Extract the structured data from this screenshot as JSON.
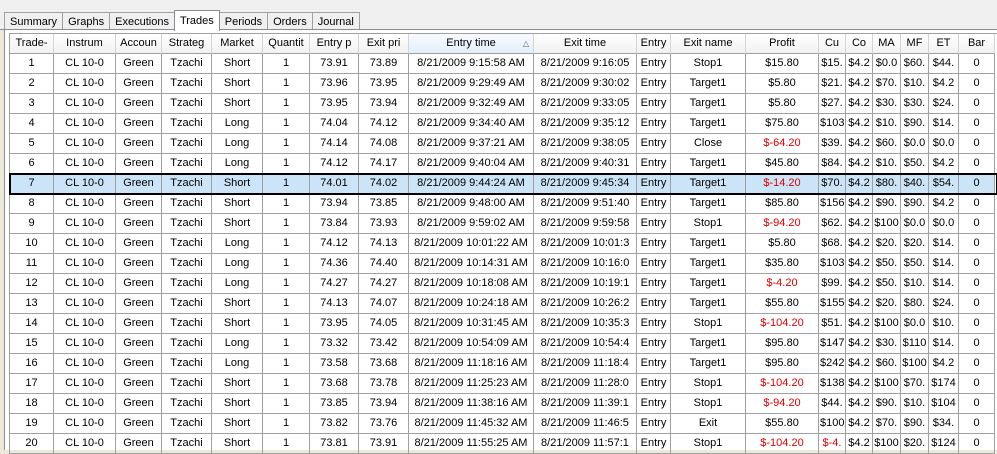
{
  "tabs": [
    {
      "label": "Summary"
    },
    {
      "label": "Graphs"
    },
    {
      "label": "Executions"
    },
    {
      "label": "Trades"
    },
    {
      "label": "Periods"
    },
    {
      "label": "Orders"
    },
    {
      "label": "Journal"
    }
  ],
  "active_tab": "Trades",
  "table": {
    "headers": [
      "Trade-",
      "Instrum",
      "Accoun",
      "Strateg",
      "Market",
      "Quantit",
      "Entry p",
      "Exit pri",
      "Entry time",
      "Exit time",
      "Entry",
      "Exit name",
      "Profit",
      "Cu",
      "Co",
      "MA",
      "MF",
      "ET",
      "Bar"
    ],
    "sorted_column": "Entry time",
    "sort_direction": "ascending",
    "selected_row": 7,
    "negative_color": "#e00000",
    "selected_bg": "#cce4f7",
    "rows": [
      [
        "1",
        "CL 10-0",
        "Green",
        "Tzachi",
        "Short",
        "1",
        "73.91",
        "73.89",
        "8/21/2009 9:15:58 AM",
        "8/21/2009 9:16:05",
        "Entry",
        "Stop1",
        "$15.80",
        "$15.",
        "$4.2",
        "$0.0",
        "$60.",
        "$44.",
        "0"
      ],
      [
        "2",
        "CL 10-0",
        "Green",
        "Tzachi",
        "Short",
        "1",
        "73.96",
        "73.95",
        "8/21/2009 9:29:49 AM",
        "8/21/2009 9:30:02",
        "Entry",
        "Target1",
        "$5.80",
        "$21.",
        "$4.2",
        "$70.",
        "$10.",
        "$4.2",
        "0"
      ],
      [
        "3",
        "CL 10-0",
        "Green",
        "Tzachi",
        "Short",
        "1",
        "73.95",
        "73.94",
        "8/21/2009 9:32:49 AM",
        "8/21/2009 9:33:05",
        "Entry",
        "Target1",
        "$5.80",
        "$27.",
        "$4.2",
        "$30.",
        "$30.",
        "$24.",
        "0"
      ],
      [
        "4",
        "CL 10-0",
        "Green",
        "Tzachi",
        "Long",
        "1",
        "74.04",
        "74.12",
        "8/21/2009 9:34:40 AM",
        "8/21/2009 9:35:12",
        "Entry",
        "Target1",
        "$75.80",
        "$103",
        "$4.2",
        "$10.",
        "$90.",
        "$14.",
        "0"
      ],
      [
        "5",
        "CL 10-0",
        "Green",
        "Tzachi",
        "Long",
        "1",
        "74.14",
        "74.08",
        "8/21/2009 9:37:21 AM",
        "8/21/2009 9:38:05",
        "Entry",
        "Close",
        "$-64.20",
        "$39.",
        "$4.2",
        "$60.",
        "$0.0",
        "$0.0",
        "0"
      ],
      [
        "6",
        "CL 10-0",
        "Green",
        "Tzachi",
        "Long",
        "1",
        "74.12",
        "74.17",
        "8/21/2009 9:40:04 AM",
        "8/21/2009 9:40:31",
        "Entry",
        "Target1",
        "$45.80",
        "$84.",
        "$4.2",
        "$10.",
        "$50.",
        "$4.2",
        "0"
      ],
      [
        "7",
        "CL 10-0",
        "Green",
        "Tzachi",
        "Short",
        "1",
        "74.01",
        "74.02",
        "8/21/2009 9:44:24 AM",
        "8/21/2009 9:45:34",
        "Entry",
        "Target1",
        "$-14.20",
        "$70.",
        "$4.2",
        "$80.",
        "$40.",
        "$54.",
        "0"
      ],
      [
        "8",
        "CL 10-0",
        "Green",
        "Tzachi",
        "Short",
        "1",
        "73.94",
        "73.85",
        "8/21/2009 9:48:00 AM",
        "8/21/2009 9:51:40",
        "Entry",
        "Target1",
        "$85.80",
        "$156",
        "$4.2",
        "$90.",
        "$90.",
        "$4.2",
        "0"
      ],
      [
        "9",
        "CL 10-0",
        "Green",
        "Tzachi",
        "Short",
        "1",
        "73.84",
        "73.93",
        "8/21/2009 9:59:02 AM",
        "8/21/2009 9:59:58",
        "Entry",
        "Stop1",
        "$-94.20",
        "$62.",
        "$4.2",
        "$100",
        "$0.0",
        "$0.0",
        "0"
      ],
      [
        "10",
        "CL 10-0",
        "Green",
        "Tzachi",
        "Long",
        "1",
        "74.12",
        "74.13",
        "8/21/2009 10:01:22 AM",
        "8/21/2009 10:01:3",
        "Entry",
        "Target1",
        "$5.80",
        "$68.",
        "$4.2",
        "$20.",
        "$20.",
        "$14.",
        "0"
      ],
      [
        "11",
        "CL 10-0",
        "Green",
        "Tzachi",
        "Long",
        "1",
        "74.36",
        "74.40",
        "8/21/2009 10:14:31 AM",
        "8/21/2009 10:16:0",
        "Entry",
        "Target1",
        "$35.80",
        "$103",
        "$4.2",
        "$50.",
        "$50.",
        "$14.",
        "0"
      ],
      [
        "12",
        "CL 10-0",
        "Green",
        "Tzachi",
        "Long",
        "1",
        "74.27",
        "74.27",
        "8/21/2009 10:18:08 AM",
        "8/21/2009 10:19:1",
        "Entry",
        "Target1",
        "$-4.20",
        "$99.",
        "$4.2",
        "$50.",
        "$10.",
        "$14.",
        "0"
      ],
      [
        "13",
        "CL 10-0",
        "Green",
        "Tzachi",
        "Short",
        "1",
        "74.13",
        "74.07",
        "8/21/2009 10:24:18 AM",
        "8/21/2009 10:26:2",
        "Entry",
        "Target1",
        "$55.80",
        "$155",
        "$4.2",
        "$20.",
        "$80.",
        "$24.",
        "0"
      ],
      [
        "14",
        "CL 10-0",
        "Green",
        "Tzachi",
        "Short",
        "1",
        "73.95",
        "74.05",
        "8/21/2009 10:31:45 AM",
        "8/21/2009 10:35:3",
        "Entry",
        "Stop1",
        "$-104.20",
        "$51.",
        "$4.2",
        "$100",
        "$0.0",
        "$10.",
        "0"
      ],
      [
        "15",
        "CL 10-0",
        "Green",
        "Tzachi",
        "Long",
        "1",
        "73.32",
        "73.42",
        "8/21/2009 10:54:09 AM",
        "8/21/2009 10:54:4",
        "Entry",
        "Target1",
        "$95.80",
        "$147",
        "$4.2",
        "$30.",
        "$110",
        "$14.",
        "0"
      ],
      [
        "16",
        "CL 10-0",
        "Green",
        "Tzachi",
        "Long",
        "1",
        "73.58",
        "73.68",
        "8/21/2009 11:18:16 AM",
        "8/21/2009 11:18:4",
        "Entry",
        "Target1",
        "$95.80",
        "$242",
        "$4.2",
        "$60.",
        "$100",
        "$4.2",
        "0"
      ],
      [
        "17",
        "CL 10-0",
        "Green",
        "Tzachi",
        "Short",
        "1",
        "73.68",
        "73.78",
        "8/21/2009 11:25:23 AM",
        "8/21/2009 11:28:0",
        "Entry",
        "Stop1",
        "$-104.20",
        "$138",
        "$4.2",
        "$100",
        "$70.",
        "$174",
        "0"
      ],
      [
        "18",
        "CL 10-0",
        "Green",
        "Tzachi",
        "Short",
        "1",
        "73.85",
        "73.94",
        "8/21/2009 11:38:16 AM",
        "8/21/2009 11:39:1",
        "Entry",
        "Stop1",
        "$-94.20",
        "$44.",
        "$4.2",
        "$90.",
        "$10.",
        "$104",
        "0"
      ],
      [
        "19",
        "CL 10-0",
        "Green",
        "Tzachi",
        "Short",
        "1",
        "73.82",
        "73.76",
        "8/21/2009 11:45:32 AM",
        "8/21/2009 11:46:5",
        "Entry",
        "Exit",
        "$55.80",
        "$100",
        "$4.2",
        "$70.",
        "$90.",
        "$34.",
        "0"
      ],
      [
        "20",
        "CL 10-0",
        "Green",
        "Tzachi",
        "Short",
        "1",
        "73.81",
        "73.91",
        "8/21/2009 11:55:25 AM",
        "8/21/2009 11:57:1",
        "Entry",
        "Stop1",
        "$-104.20",
        "$-4.",
        "$4.2",
        "$100",
        "$20.",
        "$124",
        "0"
      ]
    ]
  }
}
